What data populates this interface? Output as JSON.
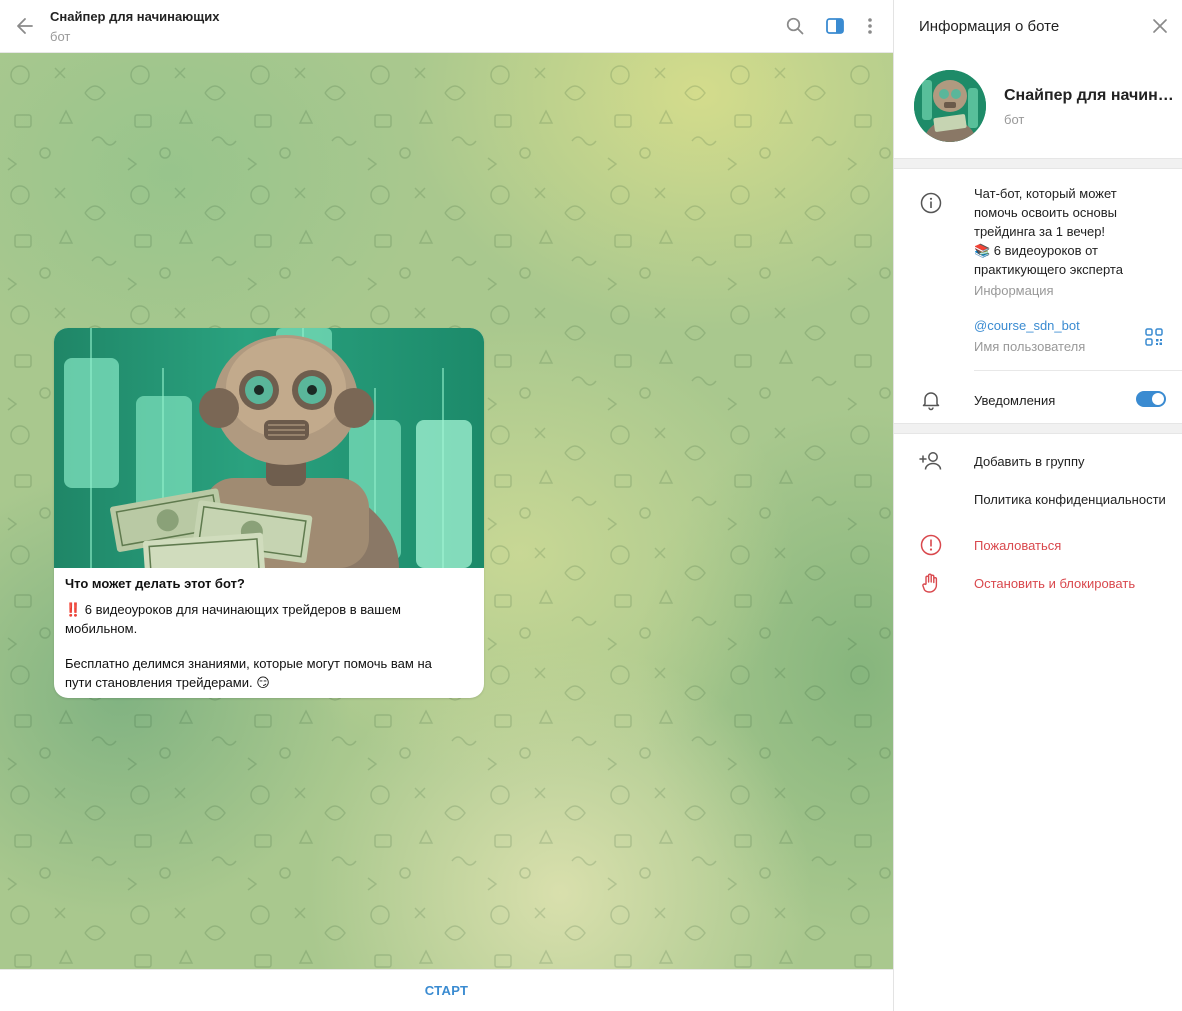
{
  "chat": {
    "title": "Снайпер для начинающих",
    "subtitle": "бот",
    "message": {
      "title": "Что может делать этот бот?",
      "lines": [
        "‼️ 6 видеоуроков для начинающих трейдеров в вашем",
        "мобильном.",
        "Бесплатно делимся знаниями, которые могут помочь вам на",
        "пути становления трейдерами. 😏"
      ]
    },
    "start_label": "СТАРТ"
  },
  "panel": {
    "title": "Информация о боте",
    "bot_name": "Снайпер для начинающих",
    "bot_subtitle": "бот",
    "about_lines": [
      "Чат-бот, который может",
      "помочь освоить основы",
      "трейдинга за 1 вечер!",
      "📚 6 видеоуроков от",
      "практикующего эксперта"
    ],
    "about_label": "Информация",
    "username": "@course_sdn_bot",
    "username_label": "Имя пользователя",
    "notifications_label": "Уведомления",
    "notifications_on": true,
    "add_to_group": "Добавить в группу",
    "privacy_policy": "Политика конфиденциальности",
    "report": "Пожаловаться",
    "stop_block": "Остановить и блокировать"
  },
  "icons": {
    "back": "arrow-left-icon",
    "search": "search-icon",
    "sidebar_toggle": "sidebar-icon",
    "more": "more-vertical-icon",
    "close": "close-icon",
    "info": "info-icon",
    "qr": "qr-code-icon",
    "bell": "bell-icon",
    "add_user": "add-user-icon",
    "report": "report-icon",
    "stop": "hand-icon"
  },
  "colors": {
    "accent": "#3a8bd1",
    "danger": "#d9484d",
    "muted": "#999999"
  }
}
